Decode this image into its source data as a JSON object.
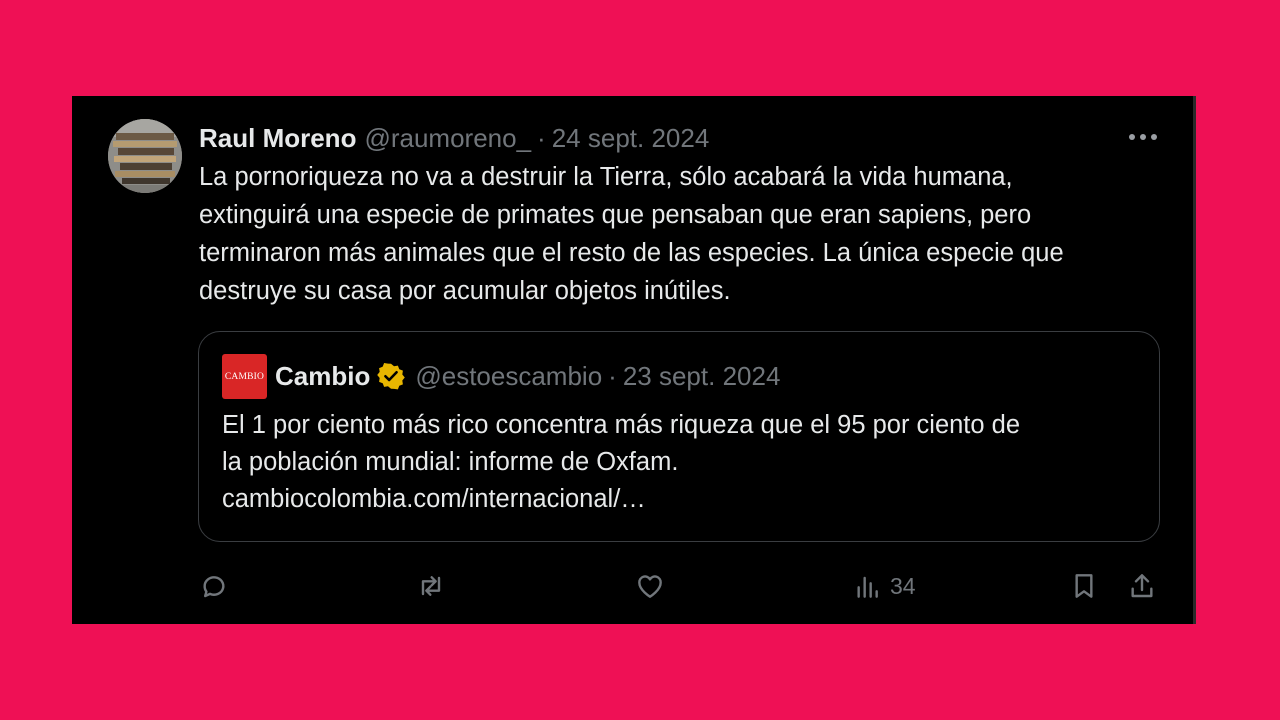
{
  "tweet": {
    "author_name": "Raul Moreno",
    "handle": "@raumoreno_",
    "separator": "·",
    "date": "24 sept. 2024",
    "text_lines": [
      "La pornoriqueza no va a destruir la Tierra, sólo acabará la vida humana,",
      "extinguirá una especie de primates que pensaban que eran sapiens, pero",
      "terminaron más animales que el resto de las especies. La única especie que",
      "destruye su casa por acumular objetos inútiles."
    ]
  },
  "quote": {
    "logo_text": "CAMBIO",
    "author_name": "Cambio",
    "verified": true,
    "handle": "@estoescambio",
    "separator": "·",
    "date": "23 sept. 2024",
    "text_lines": [
      "El 1 por ciento más rico concentra más riqueza que el 95 por ciento de",
      "la población mundial: informe de Oxfam.",
      "cambiocolombia.com/internacional/…"
    ]
  },
  "actions": {
    "views_count": "34",
    "icons": [
      "reply-icon",
      "retweet-icon",
      "like-icon",
      "views-icon",
      "bookmark-icon",
      "share-icon"
    ]
  },
  "colors": {
    "background": "#ef1055",
    "card": "#000000",
    "text": "#e7e9ea",
    "secondary_text": "#71767b",
    "verified_badge": "#e8b600",
    "logo": "#d92626"
  }
}
